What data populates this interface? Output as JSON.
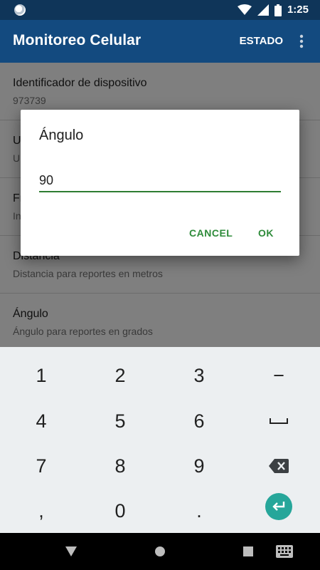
{
  "status_bar": {
    "time": "1:25",
    "icons": [
      "notification-icon",
      "wifi-icon",
      "signal-icon",
      "battery-icon"
    ]
  },
  "app_bar": {
    "title": "Monitoreo Celular",
    "action_label": "ESTADO",
    "overflow_icon": "more-vert-icon",
    "background": "#134a7f"
  },
  "preferences": [
    {
      "title": "Identificador de dispositivo",
      "summary": "973739"
    },
    {
      "title": "U",
      "summary": "U"
    },
    {
      "title": "Fr",
      "summary": "In"
    },
    {
      "title": "Distancia",
      "summary": "Distancia para reportes en metros"
    },
    {
      "title": "Ángulo",
      "summary": "Ángulo para reportes en grados"
    }
  ],
  "dialog": {
    "title": "Ángulo",
    "input_value": "90",
    "cancel_label": "CANCEL",
    "ok_label": "OK",
    "accent": "#2e8b3a"
  },
  "keyboard": {
    "keys": [
      "1",
      "2",
      "3",
      "−",
      "4",
      "5",
      "6",
      "␣",
      "7",
      "8",
      "9",
      "⌫",
      ",",
      "0",
      ".",
      "↵"
    ],
    "enter_color": "#26a69a"
  },
  "nav_bar": {
    "icons": [
      "back-icon",
      "home-icon",
      "recents-icon",
      "keyboard-switch-icon"
    ]
  }
}
